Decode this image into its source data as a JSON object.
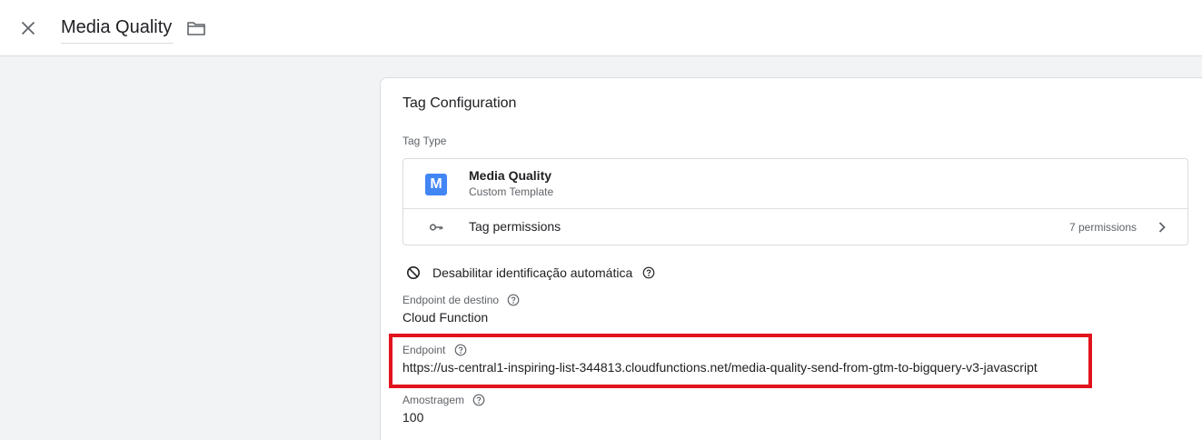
{
  "header": {
    "title": "Media Quality"
  },
  "config": {
    "section_title": "Tag Configuration",
    "tag_type_label": "Tag Type",
    "tag": {
      "logo_letter": "M",
      "name": "Media Quality",
      "subtitle": "Custom Template"
    },
    "permissions": {
      "label": "Tag permissions",
      "count": "7 permissions"
    },
    "auto_id_label": "Desabilitar identificação automática",
    "fields": [
      {
        "label": "Endpoint de destino",
        "value": "Cloud Function"
      },
      {
        "label": "Endpoint",
        "value": "https://us-central1-inspiring-list-344813.cloudfunctions.net/media-quality-send-from-gtm-to-bigquery-v3-javascript"
      },
      {
        "label": "Amostragem",
        "value": "100"
      }
    ]
  },
  "colors": {
    "accent": "#4285f4",
    "highlight": "#e1141e"
  }
}
